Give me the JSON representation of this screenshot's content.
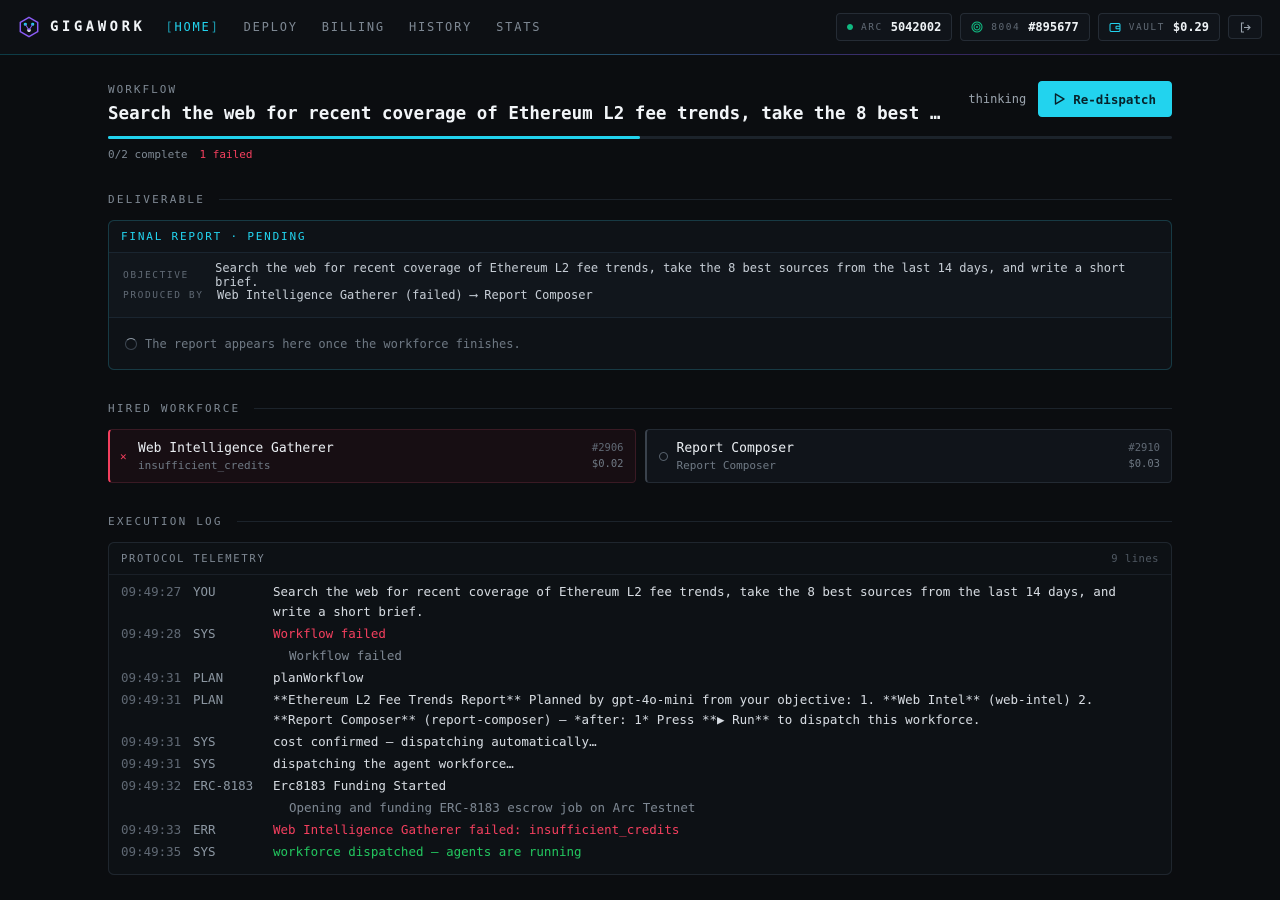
{
  "nav": {
    "brand": "GIGAWORK",
    "items": [
      {
        "label": "HOME",
        "active": true
      },
      {
        "label": "DEPLOY",
        "active": false
      },
      {
        "label": "BILLING",
        "active": false
      },
      {
        "label": "HISTORY",
        "active": false
      },
      {
        "label": "STATS",
        "active": false
      }
    ],
    "bracket_open": "[",
    "bracket_close": "]"
  },
  "status": {
    "arc_label": "ARC",
    "arc_value": "5042002",
    "id_label": "8004",
    "id_value": "#895677",
    "vault_label": "VAULT",
    "vault_value": "$0.29"
  },
  "workflow": {
    "eyebrow": "WORKFLOW",
    "title": "Search the web for recent coverage of Ethereum L2 fee trends, take the 8 best sources from the last 14 days, and write a short brief.",
    "state": "thinking",
    "redispatch_label": "Re-dispatch",
    "progress_fraction": 0.5,
    "complete_text": "0/2 complete",
    "failed_text": "1 failed"
  },
  "deliverable": {
    "section_title": "DELIVERABLE",
    "header": "FINAL REPORT · PENDING",
    "objective_key": "OBJECTIVE",
    "objective_value": "Search the web for recent coverage of Ethereum L2 fee trends, take the 8 best sources from the last 14 days, and write a short brief.",
    "produced_key": "PRODUCED BY",
    "produced_value": "Web Intelligence Gatherer (failed) ⟶ Report Composer",
    "placeholder": "The report appears here once the workforce finishes."
  },
  "workforce": {
    "section_title": "HIRED WORKFORCE",
    "agents": [
      {
        "name": "Web Intelligence Gatherer",
        "sub": "insufficient_credits",
        "id": "#2906",
        "price": "$0.02",
        "status": "failed",
        "status_glyph": "✕"
      },
      {
        "name": "Report Composer",
        "sub": "Report Composer",
        "id": "#2910",
        "price": "$0.03",
        "status": "idle"
      }
    ]
  },
  "log": {
    "section_title": "EXECUTION LOG",
    "header": "PROTOCOL TELEMETRY",
    "count": "9 lines",
    "rows": [
      {
        "time": "09:49:27",
        "tag": "YOU",
        "msg": "Search the web for recent coverage of Ethereum L2 fee trends, take the 8 best sources from the last 14 days, and write a short brief.",
        "kind": "normal"
      },
      {
        "time": "09:49:28",
        "tag": "SYS",
        "msg": "Workflow failed",
        "kind": "err",
        "sub": "Workflow failed"
      },
      {
        "time": "09:49:31",
        "tag": "PLAN",
        "msg": "planWorkflow",
        "kind": "normal"
      },
      {
        "time": "09:49:31",
        "tag": "PLAN",
        "msg": "**Ethereum L2 Fee Trends Report** Planned by gpt-4o-mini from your objective: 1. **Web Intel** (web-intel) 2. **Report Composer** (report-composer) — *after: 1* Press **▶ Run** to dispatch this workforce.",
        "kind": "normal"
      },
      {
        "time": "09:49:31",
        "tag": "SYS",
        "msg": "cost confirmed — dispatching automatically…",
        "kind": "normal"
      },
      {
        "time": "09:49:31",
        "tag": "SYS",
        "msg": "dispatching the agent workforce…",
        "kind": "normal"
      },
      {
        "time": "09:49:32",
        "tag": "ERC-8183",
        "msg": "Erc8183 Funding Started",
        "kind": "normal",
        "sub": "Opening and funding ERC-8183 escrow job on Arc Testnet"
      },
      {
        "time": "09:49:33",
        "tag": "ERR",
        "msg": "Web Intelligence Gatherer failed: insufficient_credits",
        "kind": "err"
      },
      {
        "time": "09:49:35",
        "tag": "SYS",
        "msg": "workforce dispatched — agents are running",
        "kind": "ok"
      }
    ]
  },
  "colors": {
    "accent": "#22d3ee",
    "error": "#f43f5e",
    "success": "#22c55e",
    "background": "#0b0d10"
  }
}
